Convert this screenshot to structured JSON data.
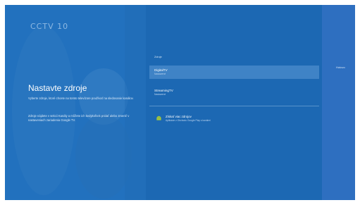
{
  "background": {
    "channel_logo": "CCTV 10"
  },
  "left": {
    "title": "Nastavte zdroje",
    "description_1": "Vyberte zdroje, ktoré chcete na tomto televízore používať na sledovanie kanálov.",
    "description_2": "Zdroje nájdete v sekcii Kanály a môžete ich kedykoľvek pridať alebo zmeniť v nastaveniach zariadenia Google TV."
  },
  "sources": {
    "section_label": "Zdroje",
    "items": [
      {
        "title": "DigitalTV",
        "subtitle": "Nastavené"
      },
      {
        "title": "StreamingTV",
        "subtitle": "Nastavené"
      }
    ],
    "add": {
      "title": "Získať viac zdrojov",
      "subtitle": "Aplikácie z Obchodu Google Play s kanálmi"
    }
  },
  "right_panel": {
    "label": "Hotovo"
  },
  "colors": {
    "screen_bg": "#1a63a8",
    "overlay": "#1c6ebe",
    "right_panel": "#2e6fc0",
    "add_icon": "#a4c639"
  }
}
